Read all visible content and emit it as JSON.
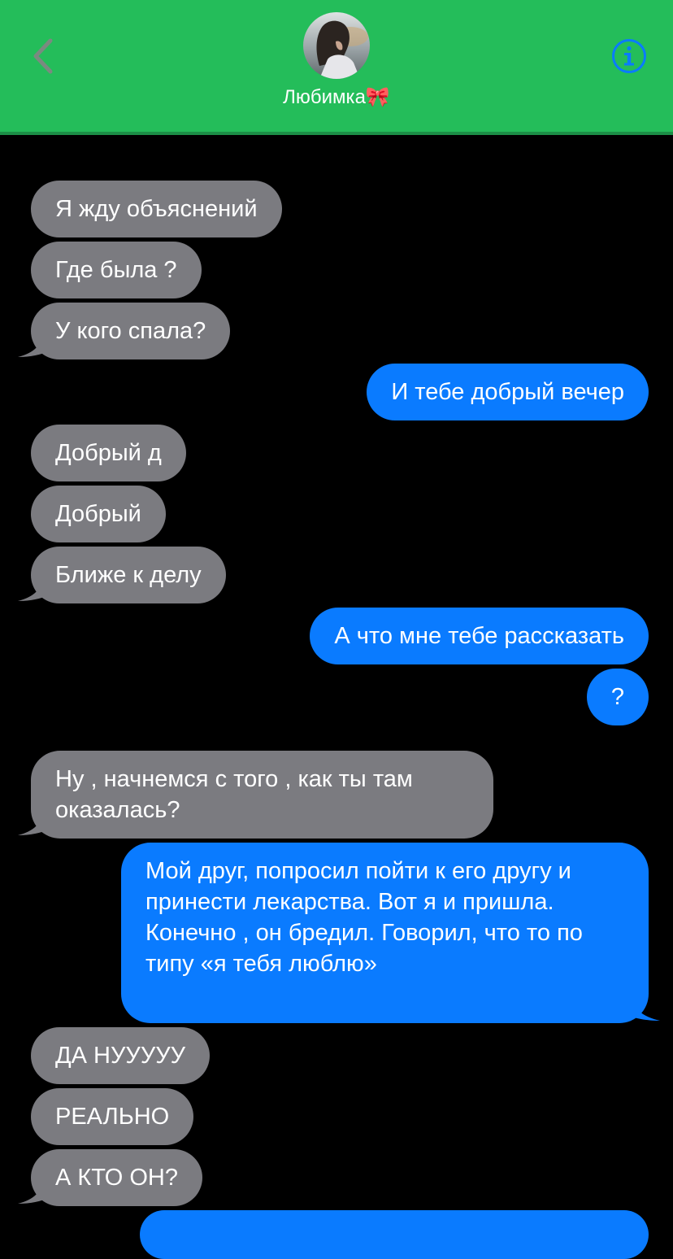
{
  "header": {
    "contact_name": "Любимка🎀",
    "back_icon": "chevron-left-icon",
    "info_icon": "info-circle-icon",
    "colors": {
      "header_bg": "#24bd5a",
      "icon": "#0a7bff"
    }
  },
  "colors": {
    "incoming": "#7b7b80",
    "outgoing": "#0a7bff",
    "background": "#000000"
  },
  "messages": [
    {
      "from": "contact",
      "text": "Я жду объяснений"
    },
    {
      "from": "contact",
      "text": "Где была ?"
    },
    {
      "from": "contact",
      "text": "У кого спала?"
    },
    {
      "from": "me",
      "text": "И тебе добрый вечер"
    },
    {
      "from": "contact",
      "text": "Добрый д"
    },
    {
      "from": "contact",
      "text": "Добрый"
    },
    {
      "from": "contact",
      "text": "Ближе к делу"
    },
    {
      "from": "me",
      "text": "А что мне тебе рассказать"
    },
    {
      "from": "me",
      "text": "?"
    },
    {
      "from": "contact",
      "text": "Ну , начнемся с того , как ты там оказалась?"
    },
    {
      "from": "me",
      "text": "Мой друг, попросил пойти к его другу и принести лекарства. Вот я и пришла. Конечно , он бредил. Говорил, что то по типу  «я тебя люблю»"
    },
    {
      "from": "contact",
      "text": "ДА НУУУУУ"
    },
    {
      "from": "contact",
      "text": "РЕАЛЬНО"
    },
    {
      "from": "contact",
      "text": "А КТО ОН?"
    }
  ]
}
